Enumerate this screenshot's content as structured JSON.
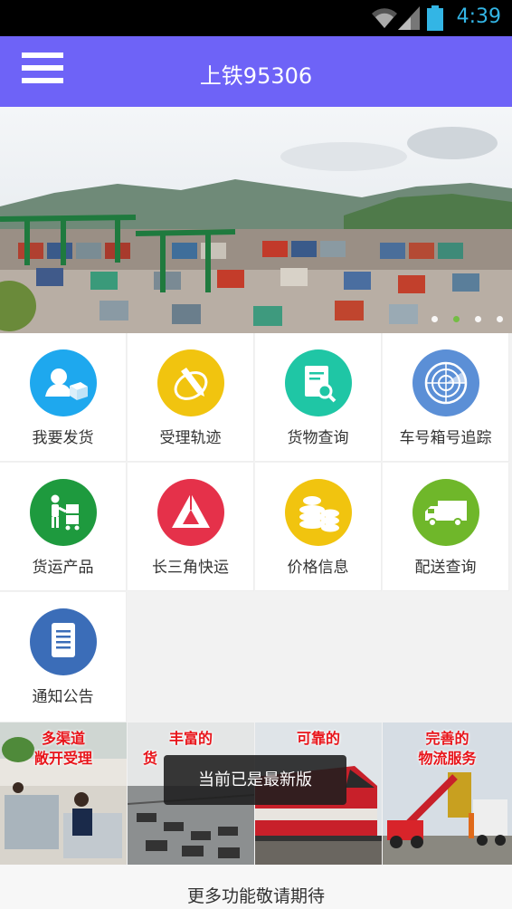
{
  "status_bar": {
    "time": "4:39"
  },
  "app_bar": {
    "title": "上铁95306"
  },
  "banner": {
    "dot_count": 4,
    "active_dot": 1
  },
  "grid_items": [
    {
      "label": "我要发货",
      "icon": "shipper-box-icon",
      "color": "#1ea8ee"
    },
    {
      "label": "受理轨迹",
      "icon": "pencil-track-icon",
      "color": "#f1c40f"
    },
    {
      "label": "货物查询",
      "icon": "document-search-icon",
      "color": "#1fc6a5"
    },
    {
      "label": "车号箱号追踪",
      "icon": "radar-icon",
      "color": "#5b8fd6"
    },
    {
      "label": "货运产品",
      "icon": "worker-cart-icon",
      "color": "#1e9a3e"
    },
    {
      "label": "长三角快运",
      "icon": "triangle-logo-icon",
      "color": "#e5314a"
    },
    {
      "label": "价格信息",
      "icon": "coins-icon",
      "color": "#f1c40f"
    },
    {
      "label": "配送查询",
      "icon": "truck-icon",
      "color": "#6fb72a"
    },
    {
      "label": "通知公告",
      "icon": "notice-icon",
      "color": "#3b6db8"
    }
  ],
  "promo_tiles": [
    {
      "caption_1": "多渠道",
      "caption_2": "敞开受理"
    },
    {
      "caption_1": "丰富的",
      "caption_2": "货"
    },
    {
      "caption_1": "可靠的",
      "caption_2": ""
    },
    {
      "caption_1": "完善的",
      "caption_2": "物流服务"
    }
  ],
  "toast": {
    "text": "当前已是最新版"
  },
  "footer": {
    "text": "更多功能敬请期待"
  }
}
